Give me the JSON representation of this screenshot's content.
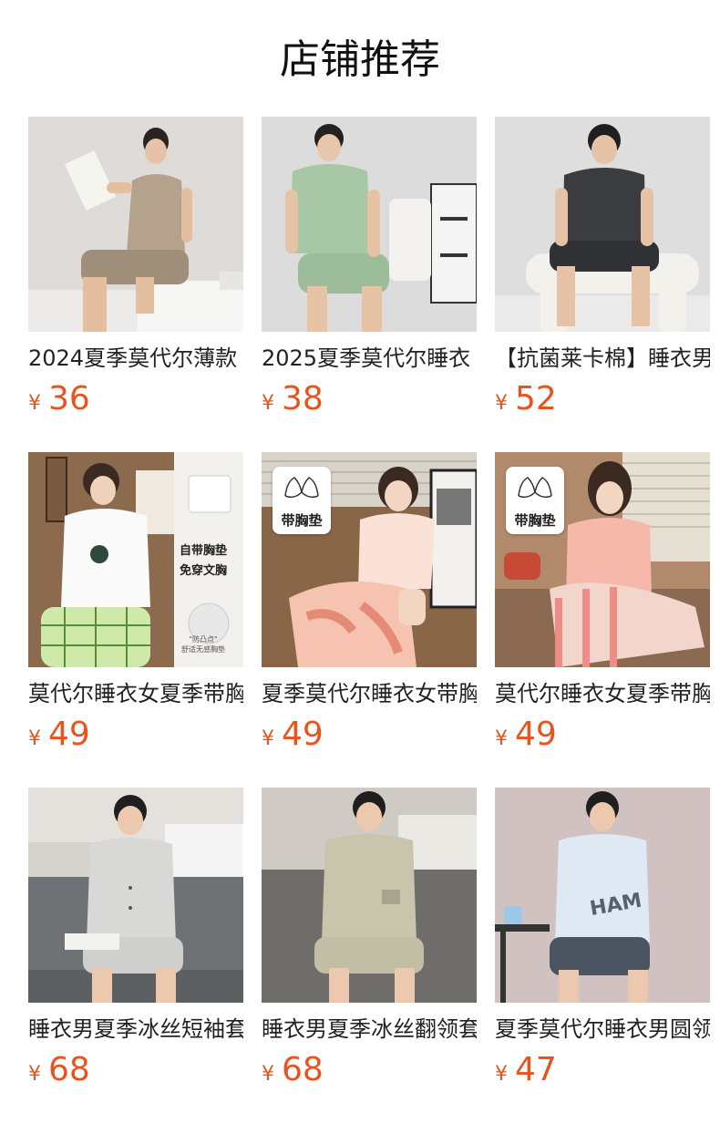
{
  "section": {
    "title": "店铺推荐"
  },
  "currency_symbol": "¥",
  "colors": {
    "price": "#e8541e"
  },
  "products": [
    {
      "name": "2024夏季莫代尔薄款",
      "price": "36"
    },
    {
      "name": "2025夏季莫代尔睡衣",
      "price": "38"
    },
    {
      "name": "【抗菌莱卡棉】睡衣男",
      "price": "52"
    },
    {
      "name": "莫代尔睡衣女夏季带胸",
      "price": "49",
      "image_text": {
        "side_line1": "自带胸垫",
        "side_line2": "免穿文胸",
        "note_line1": "\"防凸点\"",
        "note_line2": "舒适无感胸垫"
      }
    },
    {
      "name": "夏季莫代尔睡衣女带胸",
      "price": "49",
      "badge": "带胸垫"
    },
    {
      "name": "莫代尔睡衣女夏季带胸",
      "price": "49",
      "badge": "带胸垫"
    },
    {
      "name": "睡衣男夏季冰丝短袖套",
      "price": "68"
    },
    {
      "name": "睡衣男夏季冰丝翻领套",
      "price": "68"
    },
    {
      "name": "夏季莫代尔睡衣男圆领",
      "price": "47"
    }
  ]
}
